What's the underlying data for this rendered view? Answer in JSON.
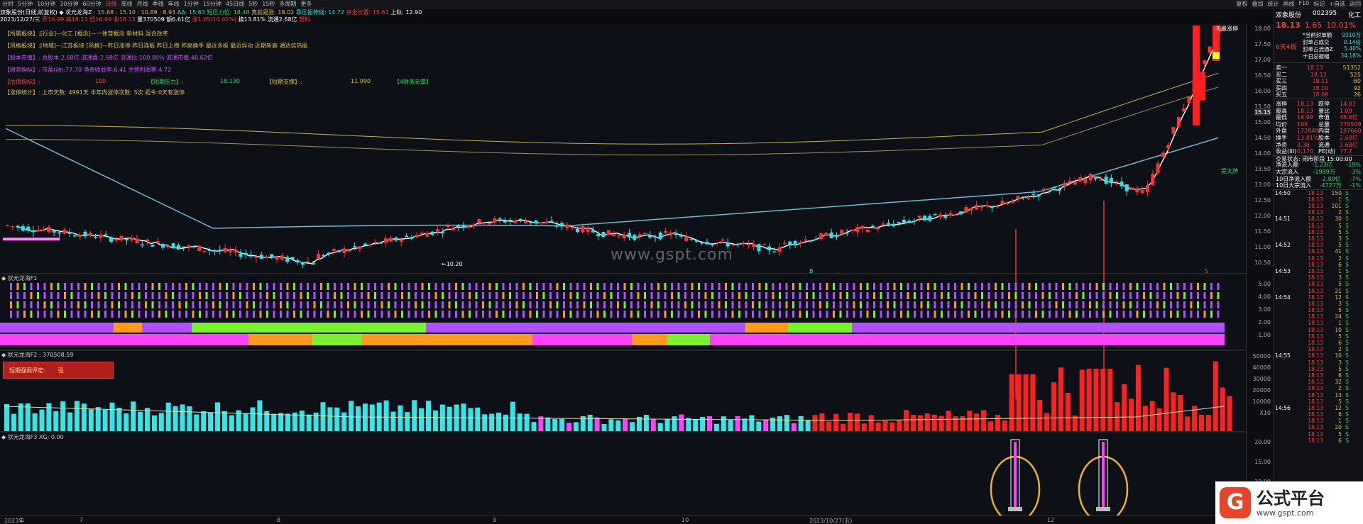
{
  "topbar": {
    "timeframes": [
      "分时",
      "5分钟",
      "10分钟",
      "30分钟",
      "60分钟",
      "日线",
      "周线",
      "月线",
      "季线",
      "年线",
      "1分钟",
      "15分钟",
      "45日线",
      "5秒",
      "15秒",
      "多周期",
      "更多"
    ],
    "active": "日线",
    "right_menu": [
      "复权",
      "叠加",
      "统计",
      "画线",
      "F10",
      "标记",
      "+自选",
      "返回"
    ]
  },
  "info_line1": {
    "name": "双象股份(日线,前复权)",
    "indicator": "◆ 状元龙海Z",
    "vals": ": 15.68 : 15.10 : 10.89 : 8.93",
    "aa": "AA: 15.63",
    "pressure": "短压力位: 18.40",
    "real_shock": "真就是涨: 18.02",
    "deep": "靠压振伸线: 14.72",
    "upper": "资金长置: 15.61",
    "up": "上轨: 12.90"
  },
  "info_line2": {
    "date": "2023/12/27/三",
    "open": "开16.99",
    "high": "高18.13",
    "low": "低16.99",
    "close": "收18.13",
    "vol": "量370509",
    "amt": "额6.61亿",
    "chg": "涨1.65(10.01%)",
    "turnover": "换13.81%",
    "float": "流通2.68亿",
    "tag": "塑料"
  },
  "annotations": {
    "sector": "【所属板块】:[行业]—化工 [概念]—一体育概念 新材料 混合改革",
    "style": "【风格板块】:[地域]—江苏板块 [风格]—昨日涨停 昨日连板 昨日上榜 昨高换手 最近多板 最近异动 近期新高 通达信热股",
    "equity": "【股本市值】: 总股本:2.68亿 流通盘:2.68亿 流通比:100.00% 流通市值:48.62亿",
    "finance": "【财务指标】: 市盈(动):77.70 净资收益率:6.41 主营利润率:4.72",
    "score_label": "【估值指标】:",
    "score": "100",
    "short_pressure_label": "【短期压力】:",
    "short_pressure": "18.130",
    "short_support_label": "【短期支撑】:",
    "short_support": "11.990",
    "status": "【4财务无雷】",
    "limit_stats": "【涨停统计】: 上市天数: 4991天 半年内涨停次数: 5次 距今:0天有涨停"
  },
  "price_axis": [
    "18.00",
    "17.50",
    "17.00",
    "16.50",
    "16.00",
    "15.50",
    "15.00",
    "14.50",
    "14.00",
    "13.50",
    "13.00",
    "12.50",
    "12.00",
    "11.50",
    "11.00",
    "10.50"
  ],
  "current_price_tag": "15.15",
  "low_label": "←10.20",
  "b_mark": "B",
  "s_mark": "S",
  "sub1": {
    "title": "◆ 状元龙海F1",
    "axis": [
      "5.00",
      "4.00",
      "3.00",
      "2.00",
      "1.00"
    ]
  },
  "sub2": {
    "title": "◆ 状元龙海F2 : 370508.59",
    "axis": [
      "50000",
      "40000",
      "30000",
      "20000",
      "10000",
      "X10"
    ],
    "strength_label": "短期强弱评定:",
    "strength_value": "强"
  },
  "sub3": {
    "title": "◆ 状元龙海F3 XG: 0.00",
    "axis": [
      "20.00",
      "15.00",
      "10.00"
    ]
  },
  "time_axis": [
    "2023年",
    "7",
    "8",
    "9",
    "10",
    "2023/10/27(五)",
    "12"
  ],
  "watermark": "www.gspt.com",
  "right_labels": {
    "top_badge": "天量涨停",
    "mid_badge": "提大牌"
  },
  "panel": {
    "name": "双象股份",
    "code": "002395",
    "industry": "化工",
    "price": "18.13",
    "change": "1.65",
    "pct": "10.01%",
    "badge": "6天4板",
    "side_labels": [
      "*当前封单额",
      "封单占成交",
      "封单占流通Z",
      "十日总振幅"
    ],
    "side_vals": [
      "9310万",
      "0.14倍",
      "5.40%",
      "34.18%"
    ],
    "book": [
      {
        "l": "卖一",
        "p": "18.13",
        "v": "51352"
      },
      {
        "l": "买二",
        "p": "18.12",
        "v": "525"
      },
      {
        "l": "买三",
        "p": "18.11",
        "v": "80"
      },
      {
        "l": "买四",
        "p": "18.10",
        "v": "92"
      },
      {
        "l": "买五",
        "p": "18.09",
        "v": "26"
      }
    ],
    "stats": [
      [
        "涨停",
        "18.13",
        "跌停",
        "14.83"
      ],
      [
        "最高",
        "18.13",
        "量比",
        "1.09"
      ],
      [
        "最低",
        "16.99",
        "市值",
        "48.6亿"
      ],
      [
        "均价",
        "168",
        "总量",
        "370509"
      ],
      [
        "外盘",
        "172849",
        "内盘",
        "197660"
      ],
      [
        "换手",
        "13.81%",
        "股本",
        "2.68亿"
      ],
      [
        "净资",
        "3.38",
        "流通",
        "2.68亿"
      ],
      [
        "收益(III)",
        "0.170",
        "PE(动)",
        "77.7"
      ]
    ],
    "trade_status": "交易状态: 闭市阶段 15:00:00",
    "flows": [
      [
        "净流入额",
        "-1.23亿",
        "-19%"
      ],
      [
        "大宗流入",
        "-1989万",
        "-3%"
      ],
      [
        "10日净流入额",
        "-2.89亿",
        "-7%"
      ],
      [
        "10日大宗流入",
        "-4727万",
        "-1%"
      ]
    ],
    "ticks": [
      [
        "14:50",
        "18.13",
        "150",
        "S"
      ],
      [
        "",
        "18.13",
        "1",
        "S"
      ],
      [
        "",
        "18.13",
        "101",
        "S"
      ],
      [
        "",
        "18.13",
        "2",
        "S"
      ],
      [
        "14:51",
        "18.13",
        "30",
        "S"
      ],
      [
        "",
        "18.13",
        "5",
        "S"
      ],
      [
        "",
        "18.13",
        "5",
        "S"
      ],
      [
        "",
        "18.13",
        "3",
        "S"
      ],
      [
        "14:52",
        "18.13",
        "5",
        "S"
      ],
      [
        "",
        "18.13",
        "41",
        "S"
      ],
      [
        "",
        "18.13",
        "2",
        "S"
      ],
      [
        "",
        "18.13",
        "6",
        "S"
      ],
      [
        "14:53",
        "18.13",
        "1",
        "S"
      ],
      [
        "",
        "18.13",
        "3",
        "S"
      ],
      [
        "",
        "18.13",
        "5",
        "S"
      ],
      [
        "",
        "18.13",
        "21",
        "S"
      ],
      [
        "14:54",
        "18.13",
        "12",
        "S"
      ],
      [
        "",
        "18.13",
        "3",
        "S"
      ],
      [
        "",
        "18.13",
        "5",
        "S"
      ],
      [
        "",
        "18.13",
        "24",
        "S"
      ],
      [
        "",
        "18.13",
        "1",
        "S"
      ],
      [
        "",
        "18.13",
        "10",
        "S"
      ],
      [
        "",
        "18.13",
        "5",
        "S"
      ],
      [
        "",
        "18.13",
        "6",
        "S"
      ],
      [
        "",
        "18.13",
        "2",
        "S"
      ],
      [
        "14:55",
        "18.13",
        "10",
        "S"
      ],
      [
        "",
        "18.13",
        "3",
        "S"
      ],
      [
        "",
        "18.13",
        "5",
        "S"
      ],
      [
        "",
        "18.13",
        "6",
        "S"
      ],
      [
        "",
        "18.13",
        "32",
        "S"
      ],
      [
        "",
        "18.13",
        "2",
        "S"
      ],
      [
        "",
        "18.13",
        "13",
        "S"
      ],
      [
        "",
        "18.13",
        "5",
        "S"
      ],
      [
        "14:56",
        "18.13",
        "12",
        "S"
      ],
      [
        "",
        "18.13",
        "6",
        "S"
      ],
      [
        "",
        "18.13",
        "1",
        "S"
      ],
      [
        "",
        "18.13",
        "20",
        "S"
      ],
      [
        "",
        "18.13",
        "5",
        "S"
      ],
      [
        "",
        "18.13",
        "6",
        "S"
      ]
    ]
  },
  "logo": {
    "mark": "G",
    "name": "公式平台",
    "url": "www.gspt.com"
  },
  "colors": {
    "up": "#ff3030",
    "down": "#30e0e8",
    "ma1": "#ffffff",
    "ma2": "#6ab8d8",
    "band_upper": "#c8b040",
    "band_lower": "#a09050"
  }
}
